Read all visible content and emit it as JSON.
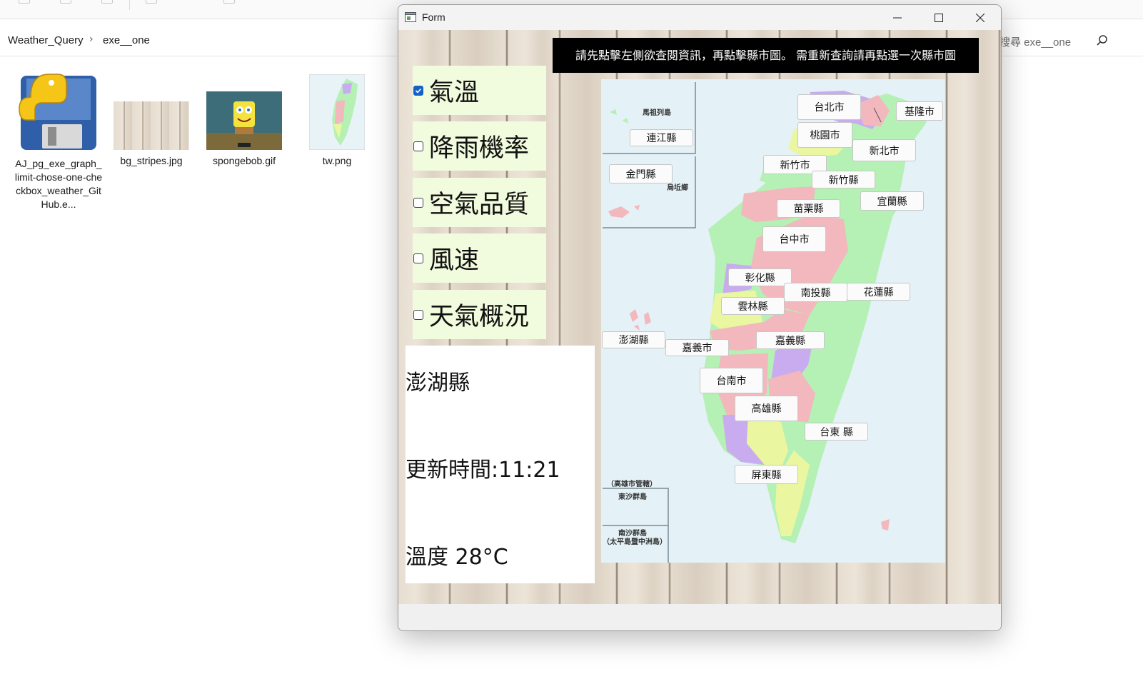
{
  "explorer": {
    "breadcrumb": [
      "Weather_Query",
      "exe__one"
    ],
    "search_placeholder": "搜尋 exe__one",
    "files": [
      {
        "name": "AJ_pg_exe_graph_limit-chose-one-checkbox_weather_GitHub.e...",
        "icon": "python-exe-icon"
      },
      {
        "name": "bg_stripes.jpg",
        "icon": "wood-image-thumbnail"
      },
      {
        "name": "spongebob.gif",
        "icon": "spongebob-thumbnail"
      },
      {
        "name": "tw.png",
        "icon": "taiwan-map-thumbnail"
      }
    ]
  },
  "window": {
    "title": "Form",
    "controls": [
      "minimize-icon",
      "maximize-icon",
      "close-icon"
    ]
  },
  "banner": "請先點擊左側欲查閱資訊，再點擊縣市圖。 需重新查詢請再點選一次縣市圖",
  "checkboxes": [
    {
      "label": "氣溫",
      "checked": true
    },
    {
      "label": "降雨機率",
      "checked": false
    },
    {
      "label": "空氣品質",
      "checked": false
    },
    {
      "label": "風速",
      "checked": false
    },
    {
      "label": "天氣概況",
      "checked": false
    }
  ],
  "info": {
    "county": "澎湖縣",
    "update_time": "更新時間:11:21",
    "temperature": "溫度 28°C"
  },
  "map": {
    "region_labels": [
      "馬祖列島",
      "烏坵鄉",
      "（高雄市管轄）",
      "東沙群島",
      "南沙群島",
      "（太平島暨中洲島）"
    ],
    "county_buttons": [
      "台北市",
      "基隆市",
      "連江縣",
      "桃園市",
      "新北市",
      "新竹市",
      "金門縣",
      "新竹縣",
      "苗栗縣",
      "宜蘭縣",
      "台中市",
      "彰化縣",
      "南投縣",
      "花蓮縣",
      "雲林縣",
      "澎湖縣",
      "嘉義縣",
      "嘉義市",
      "台南市",
      "高雄縣",
      "台東 縣",
      "屏東縣"
    ],
    "colors": {
      "sea": "#e4f1f6",
      "pink": "#f2b8bd",
      "green": "#b5f0b5",
      "yellow": "#eaf7a0",
      "purple": "#c9acf0"
    }
  }
}
